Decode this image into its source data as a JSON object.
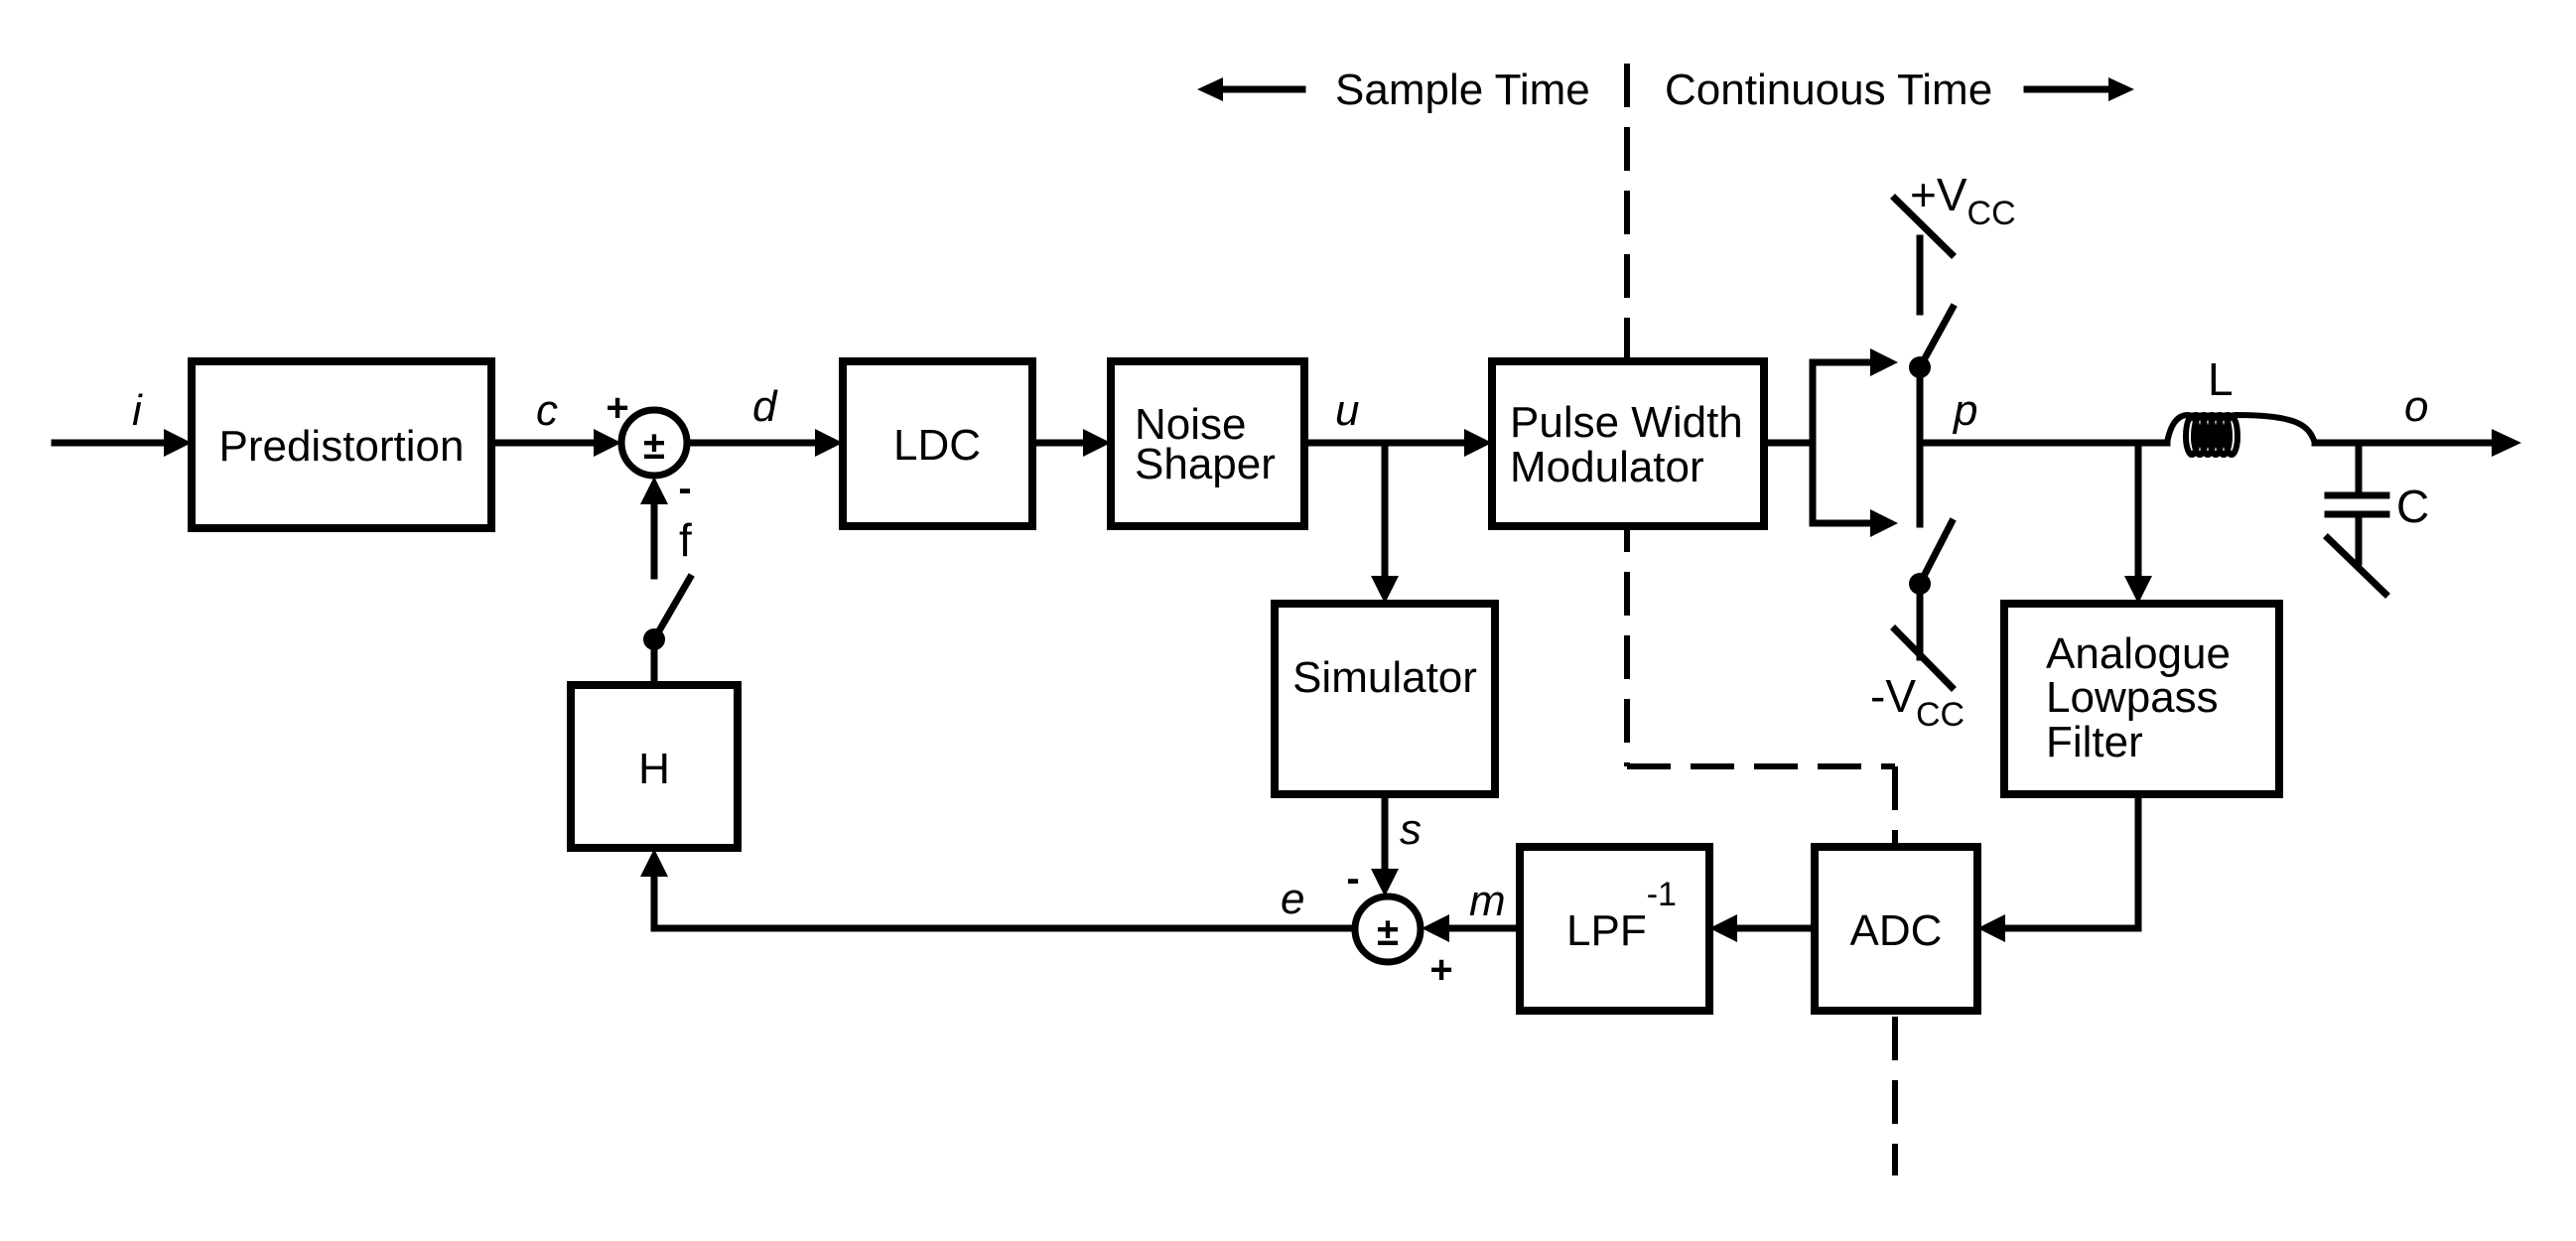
{
  "header": {
    "left_label": "Sample Time",
    "right_label": "Continuous Time"
  },
  "blocks": {
    "predistortion": "Predistortion",
    "ldc": "LDC",
    "noise_shaper": [
      "Noise",
      "Shaper"
    ],
    "pwm": [
      "Pulse Width",
      "Modulator"
    ],
    "simulator": "Simulator",
    "h": "H",
    "lpf_inv": "LPF",
    "lpf_inv_sup": "-1",
    "adc": "ADC",
    "analogue_lpf": [
      "Analogue",
      "Lowpass",
      "Filter"
    ]
  },
  "signals": {
    "i": "i",
    "c": "c",
    "d": "d",
    "u": "u",
    "p": "p",
    "o": "o",
    "f": "f",
    "s": "s",
    "e": "e",
    "m": "m"
  },
  "summers": {
    "top": {
      "symbol": "±",
      "in_plus": "+",
      "in_minus": "-"
    },
    "bottom": {
      "symbol": "±",
      "in_minus": "-",
      "in_plus": "+"
    }
  },
  "components": {
    "inductor": "L",
    "capacitor": "C",
    "vcc_pos_sign": "+V",
    "vcc_neg_sign": "-V",
    "vcc_sub": "CC"
  }
}
